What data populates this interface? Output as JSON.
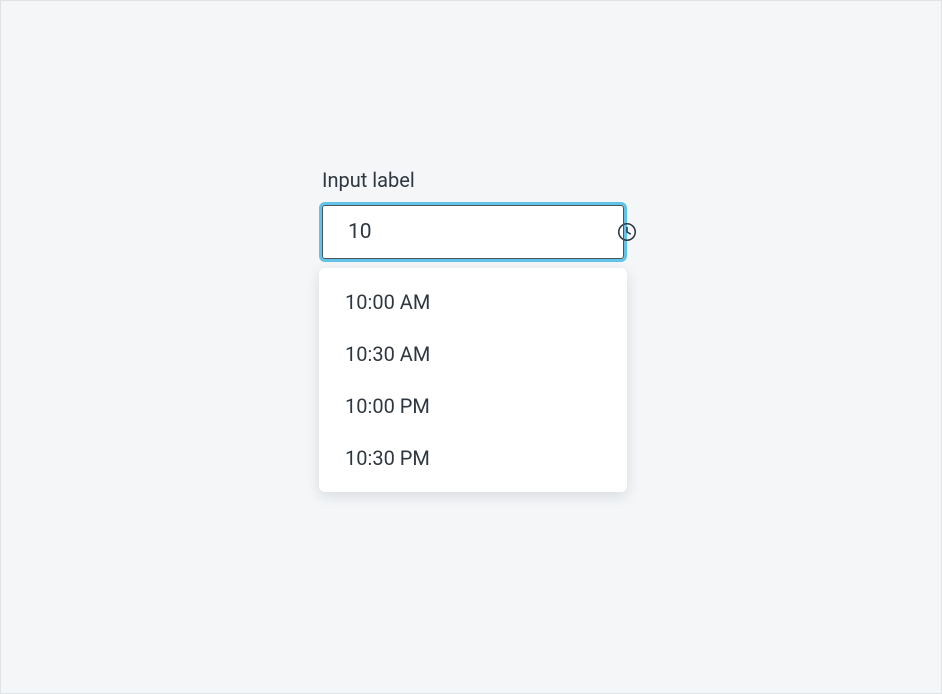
{
  "timePicker": {
    "label": "Input label",
    "value": "10",
    "iconName": "clock-icon",
    "options": [
      "10:00 AM",
      "10:30 AM",
      "10:00 PM",
      "10:30 PM"
    ]
  }
}
